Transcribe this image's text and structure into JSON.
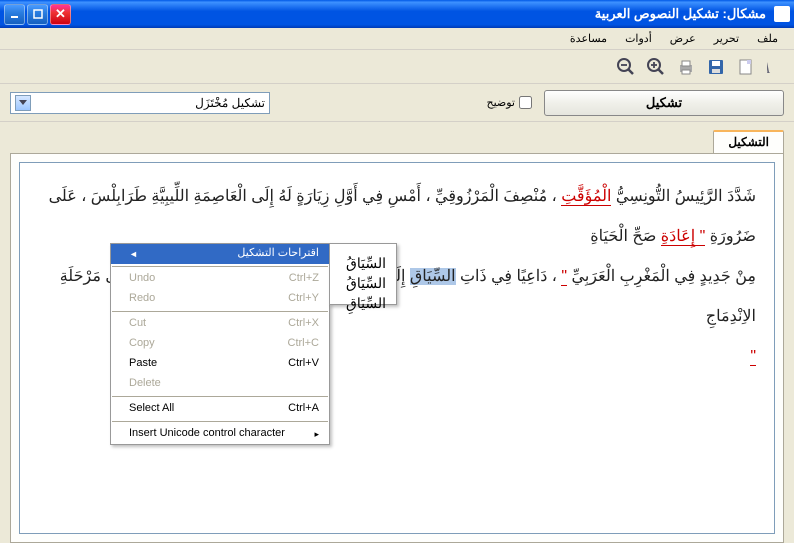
{
  "titlebar": {
    "title": "مشكال: تشكيل النصوص العربية"
  },
  "menubar": {
    "items": [
      "ملف",
      "تحرير",
      "عرض",
      "أدوات",
      "مساعدة"
    ]
  },
  "toolbar": {
    "icons": [
      "font",
      "new",
      "save",
      "print",
      "zoom-in",
      "zoom-out"
    ]
  },
  "action_row": {
    "main_button": "تشكيل",
    "checkbox_label": "توضيح",
    "combo_value": "تشكيل مُخْتَزَل"
  },
  "tab": {
    "label": "التشكيل"
  },
  "text": {
    "line1_a": "شَدَّدَ الرَّئِيسُ التُّونِسِيُّ ",
    "line1_hl1": "الْمُؤَقَّتِ",
    "line1_b": " ، مُنْصِفَ الْمَرْزُوقِيِّ ، أَمْسِ فِي أَوَّلِ زِيَارَةٍ لَهُ إِلَى الْعَاصِمَةِ اللِّيبِيَّةِ طَرَابِلْسَ ، عَلَى ضَرُورَةِ ",
    "line1_hl2": "\" إِعَادَةِ",
    "line1_c": " صَحِّ الْحَيَاةِ",
    "line2_a": "مِنْ جَدِيدٍ فِي الْمَغْرِبِ الْعَرَبِيِّ ",
    "line2_hl3": "\"",
    "line2_b": " ، دَاعِيًا فِي ذَاتِ ",
    "line2_sel": "السِّيَاقِ",
    "line2_c": " إِلَى ",
    "line2_hl4": "\"",
    "line2_d": " تَجَاوُزِ مَرْحَلَةِ التَّعَاوُنِ بَيْنَ تُونِسَ وَلِيبْيَا إِلَى مَرْحَلَةِ الاِنْدِمَاجِ",
    "line3": "\""
  },
  "context_menu": {
    "suggestions": "اقتراحات التشكيل",
    "undo": "Undo",
    "undo_key": "Ctrl+Z",
    "redo": "Redo",
    "redo_key": "Ctrl+Y",
    "cut": "Cut",
    "cut_key": "Ctrl+X",
    "copy": "Copy",
    "copy_key": "Ctrl+C",
    "paste": "Paste",
    "paste_key": "Ctrl+V",
    "delete": "Delete",
    "select_all": "Select All",
    "select_all_key": "Ctrl+A",
    "unicode": "Insert Unicode control character"
  },
  "submenu": {
    "items": [
      "السِّيَاقُ",
      "السِّيَاقُ",
      "السِّيَاقِ"
    ]
  }
}
